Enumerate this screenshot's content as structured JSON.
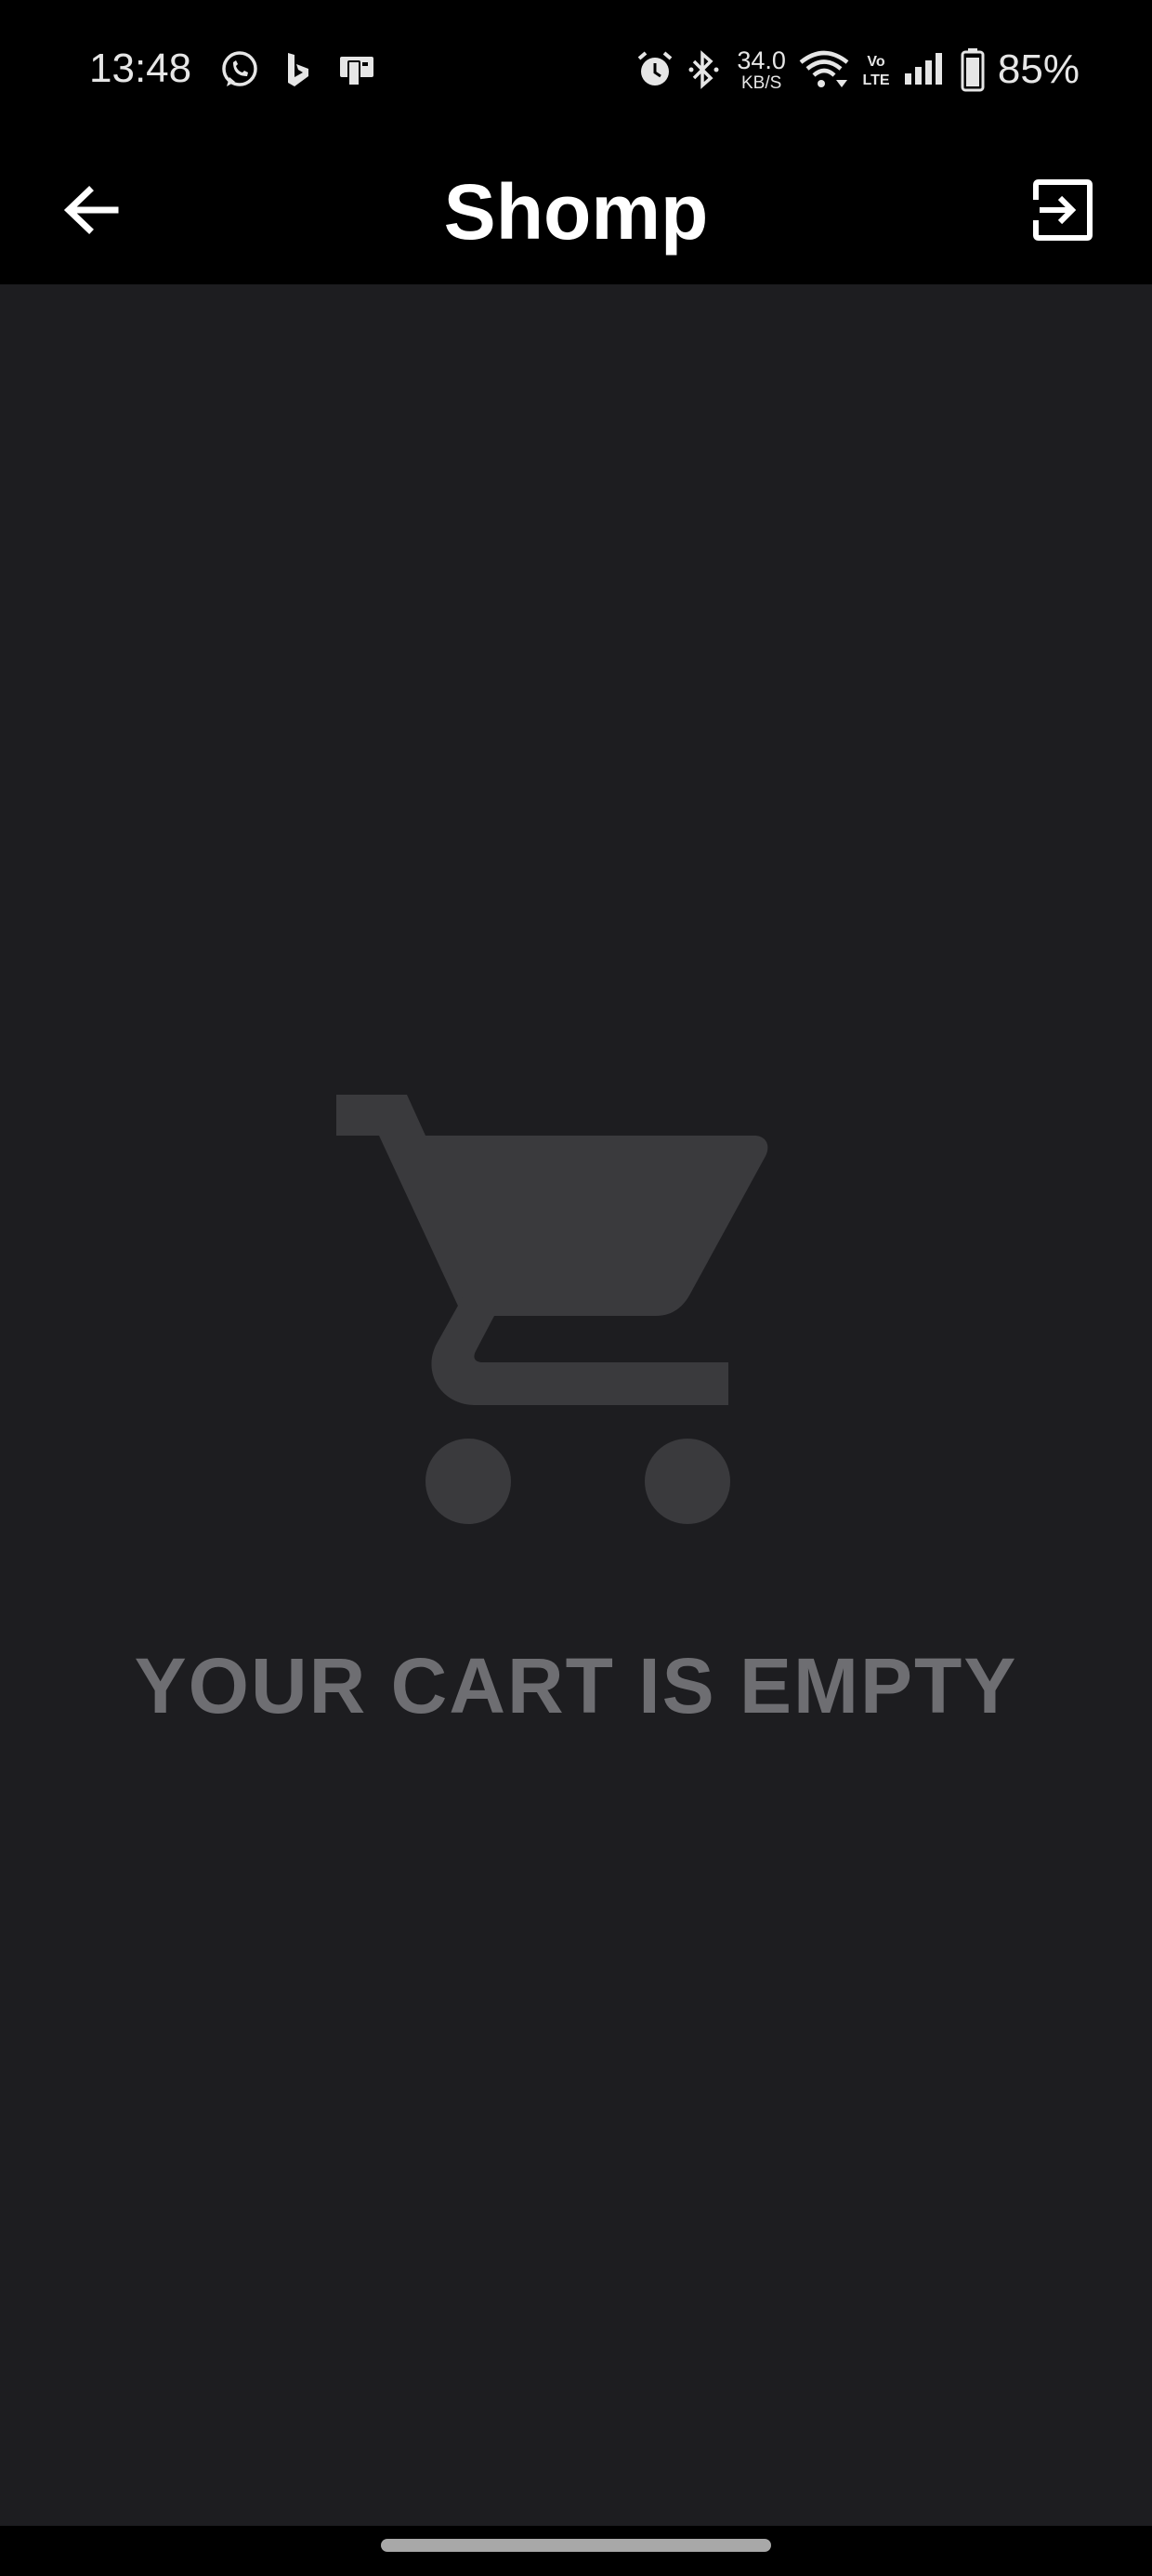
{
  "status_bar": {
    "time": "13:48",
    "left_icons": [
      "whatsapp-icon",
      "bing-icon",
      "sim-toolkit-icon"
    ],
    "right_icons": [
      "alarm-icon",
      "bluetooth-icon",
      "wifi-icon",
      "volte-icon",
      "signal-icon",
      "battery-icon"
    ],
    "net_speed_value": "34.0",
    "net_speed_unit": "KB/S",
    "volte_label": "Vo LTE",
    "battery_percent": "85%"
  },
  "app_bar": {
    "title": "Shomp",
    "back_icon": "arrow-left-icon",
    "logout_icon": "exit-to-app-icon"
  },
  "content": {
    "illustration_icon": "shopping-cart-icon",
    "empty_message": "YOUR CART IS EMPTY"
  },
  "colors": {
    "status_bar_bg": "#000000",
    "app_bar_bg": "#000000",
    "content_bg": "#1d1d20",
    "cart_icon": "#3a3a3d",
    "empty_text": "#6e6e72",
    "title_text": "#ffffff"
  }
}
